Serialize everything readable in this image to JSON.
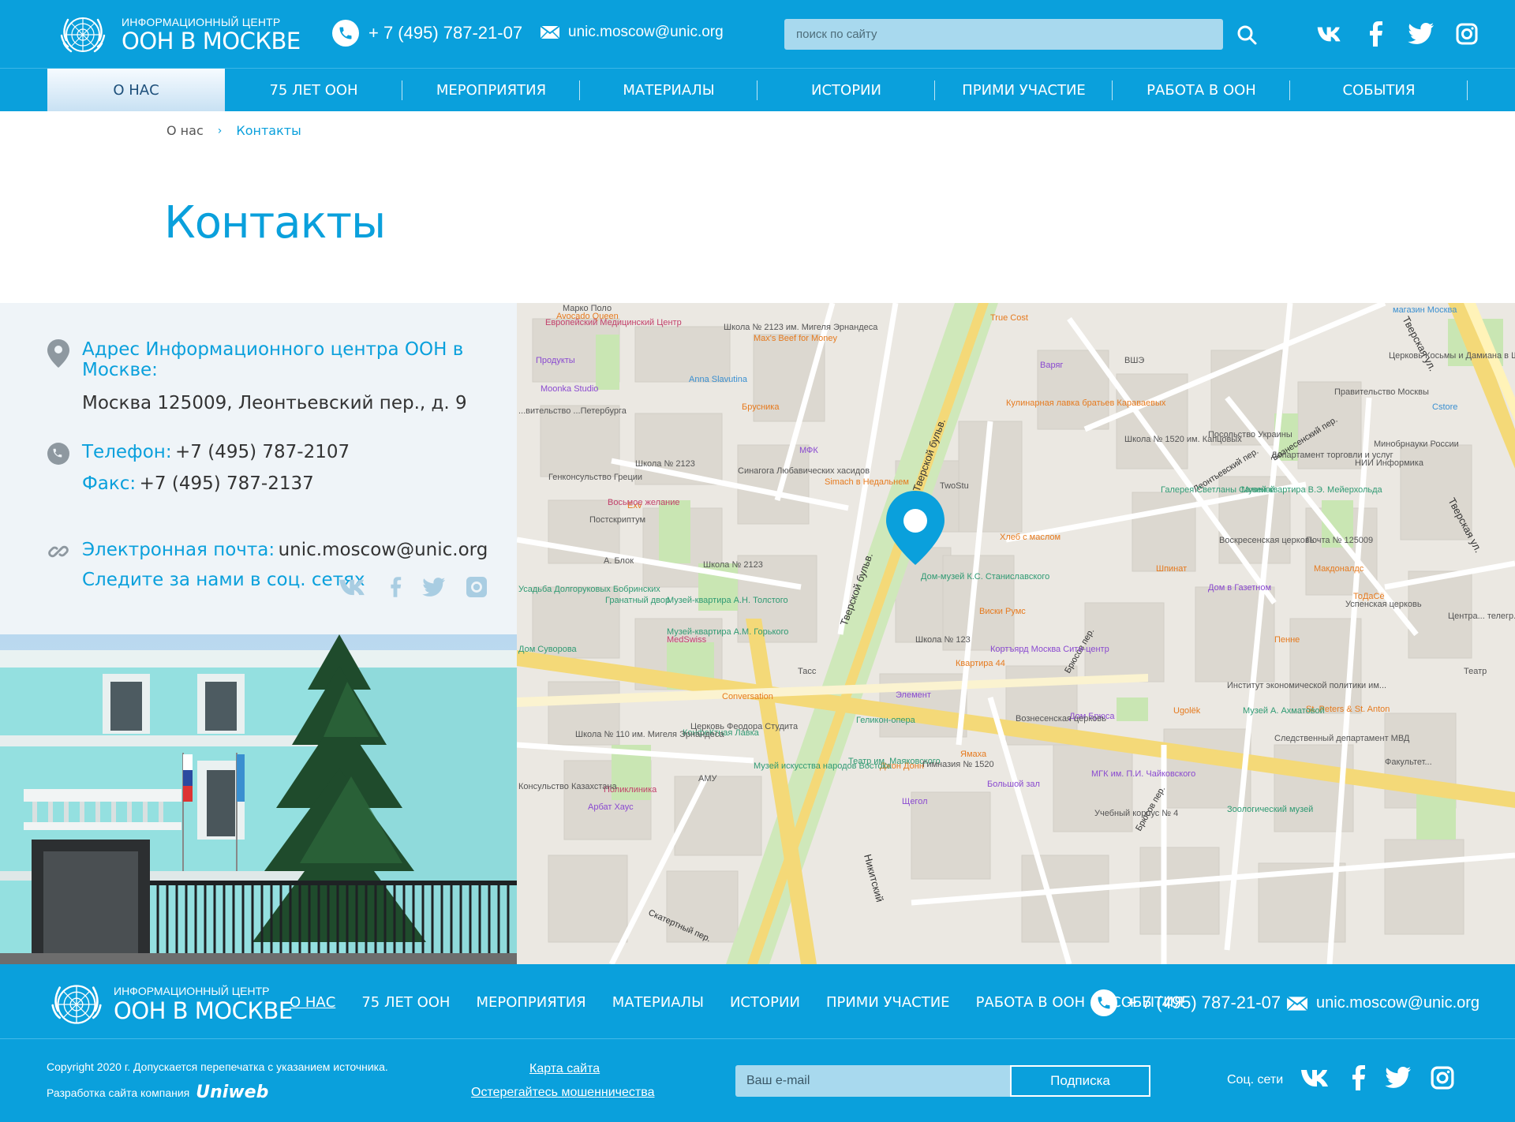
{
  "header": {
    "logo_small": "ИНФОРМАЦИОННЫЙ ЦЕНТР",
    "logo_big": "ООН В МОСКВЕ",
    "phone": "+ 7 (495) 787-21-07",
    "email": "unic.moscow@unic.org",
    "search_placeholder": "поиск по сайту",
    "social": [
      "vk-icon",
      "facebook-icon",
      "twitter-icon",
      "instagram-icon"
    ]
  },
  "nav": {
    "items": [
      {
        "label": "О НАС",
        "active": true
      },
      {
        "label": "75 ЛЕТ ООН"
      },
      {
        "label": "МЕРОПРИЯТИЯ"
      },
      {
        "label": "МАТЕРИАЛЫ"
      },
      {
        "label": "ИСТОРИИ"
      },
      {
        "label": "ПРИМИ УЧАСТИЕ"
      },
      {
        "label": "РАБОТА В ООН"
      },
      {
        "label": "СОБЫТИЯ"
      }
    ]
  },
  "breadcrumb": {
    "home": "О нас",
    "separator": "›",
    "current": "Контакты"
  },
  "page_title": "Контакты",
  "contacts": {
    "address_label": "Адрес Информационного центра ООН в Москве:",
    "address_value": "Москва 125009, Леонтьевский пер., д. 9",
    "phone_label": "Телефон:",
    "phone_value": "+7 (495) 787-2107",
    "fax_label": "Факс:",
    "fax_value": "+7 (495) 787-2137",
    "email_label": "Электронная почта:",
    "email_value": "unic.moscow@unic.org",
    "follow_label": "Следите за нами в соц. сетях"
  },
  "map": {
    "labels": {
      "tverskoy1": "Тверской бульв.",
      "tverskoy2": "Тверской бульв.",
      "tverskaya1": "Тверская ул.",
      "tverskaya2": "Тверская ул.",
      "nikitsky": "Никитский",
      "bryusov": "Брюсов пер.",
      "bryusov2": "Брюсов пер.",
      "leontievsky": "Леонтьевский пер.",
      "voznesensky": "Вознесенский пер.",
      "skaterny": "Скатертный пер.",
      "dom_muzey": "Дом-музей К.С. Станиславского",
      "yamakha": "Ямаха",
      "viski": "Виски Румс",
      "hleb": "Хлеб с маслом",
      "twostu": "TwoStu",
      "kulinarnaya": "Кулинарная лавка братьев Караваевых",
      "simach": "Simach в Недальнем",
      "mfk": "МФК",
      "brusnika": "Брусника",
      "maxs": "Max's Beef for Money",
      "true_cost": "True Cost",
      "varyag": "Варяг",
      "vshe": "ВШЭ",
      "school_1520": "Школа № 1520 им. Капцовых",
      "posolstvo": "Посольство Украины",
      "departament": "Департамент торговли и услуг",
      "pravitelstvo": "Правительство Москвы",
      "minobr": "Минобрнауки России",
      "nii": "НИИ Информика",
      "galereya": "Галерея Светланы Сажиной",
      "muzey_kvartira": "Музей-квартира В.Э. Мейерхольда",
      "voskresenskaya": "Воскресенская церковь",
      "pochta": "Почта № 125009",
      "shpinat": "Шпинат",
      "makdonalds": "Макдоналдс",
      "todase": "ТоДаСё",
      "uspenskaya": "Успенская церковь",
      "dom_gazetnom": "Дом в Газетном",
      "penne": "Пенне",
      "institut": "Институт экономической политики им...",
      "sledstvenny": "Следственный департамент МВД",
      "st_peters": "St. Peters & St. Anton",
      "zoolog": "Зоологический музей",
      "fakultet": "Факультет...",
      "muzey_akhmatovoy": "Музей А. Ахматовой",
      "dom_bryusa": "Дом Брюса",
      "ugolek": "Ugolёk",
      "mgk": "МГК им. П.И. Чайковского",
      "bolshoy_zal": "Большой зал",
      "uchebny": "Учебный корпус № 4",
      "korpyard": "Кортъярд Москва Сити-центр",
      "kvartira44": "Квартира 44",
      "shkola_123": "Школа № 123",
      "element": "Элемент",
      "vozn_cerkov": "Вознесенская церковь",
      "gimnaziya": "Гимназия № 1520",
      "teatr_mayak": "Театр им. Маяковского",
      "shchegol": "Щегол",
      "dzhon_donn": "Джон Донн",
      "muzey_vostoka": "Музей искусства народов Востока",
      "gelikon": "Геликон-опера",
      "conversation": "Conversation",
      "tass": "Тасс",
      "medswiss": "MedSwiss",
      "cerkov_feodora": "Церковь Феодора Студита",
      "konfetnaya": "КонфеКтная Лавка",
      "amu": "АМУ",
      "shkola_110": "Школа № 110 им. Мигеля Эрнандеса",
      "poliklinika": "Поликлиника",
      "arbat_haus": "Арбат Хаус",
      "konsulstvo_kaz": "Консульство Казахстана",
      "dom_suvorova": "Дом Суворова",
      "usadba": "Усадьба Долгоруковых Бобринских",
      "granatny": "Гранатный двор",
      "muzey_tolstoy": "Музей-квартира А.Н. Толстого",
      "muzey_gorky": "Музей-квартира А.М. Горького",
      "a_blok": "А. Блок",
      "shkola_2123a": "Школа № 2123",
      "shkola_2123b": "Школа № 2123",
      "shkola_2123c": "Школа № 2123 им. Мигеля Эрнандеса",
      "postskriptum": "Постскриптум",
      "vosmoe": "Восьмое желание",
      "sinagoga": "Синагога Любавических хасидов",
      "genkonsulstvo": "Генконсульство Греции",
      "exv": "Exv",
      "moonka": "Moonka Studio",
      "anna": "Anna Slavutina",
      "avocado": "Avocado Queen",
      "marko": "Марко Поло",
      "evrop": "Европейский Медицинский Центр",
      "produkty": "Продукты",
      "predstav_peterburg": "...вительство ...Петербурга",
      "cstore": "Cstore",
      "cerkov_damiana": "Церковь Косьмы и Дамиана в Шубине",
      "magazin_moskva": "магазин Москва",
      "centralny": "Центра... телегр...",
      "teatr": "Театр"
    }
  },
  "footer": {
    "logo_small": "ИНФОРМАЦИОННЫЙ ЦЕНТР",
    "logo_big": "ООН В МОСКВЕ",
    "nav": [
      "О НАС",
      "75 ЛЕТ ООН",
      "МЕРОПРИЯТИЯ",
      "МАТЕРИАЛЫ",
      "ИСТОРИИ",
      "ПРИМИ УЧАСТИЕ",
      "РАБОТА В ООН",
      "СОБЫТИЯ"
    ],
    "phone": "+ 7 (495) 787-21-07",
    "email": "unic.moscow@unic.org",
    "copyright": "Copyright 2020 г. Допускается перепечатка с указанием источника.",
    "developer_label": "Разработка сайта компания",
    "developer_name": "Uniweb",
    "sitemap": "Карта сайта",
    "fraud": "Остерегайтесь мошенничества",
    "email_placeholder": "Ваш e-mail",
    "subscribe": "Подписка",
    "social_label": "Соц. сети"
  },
  "colors": {
    "brand": "#0aa0dc",
    "panel": "#eff4f8",
    "marker": "#0aa0dc"
  }
}
